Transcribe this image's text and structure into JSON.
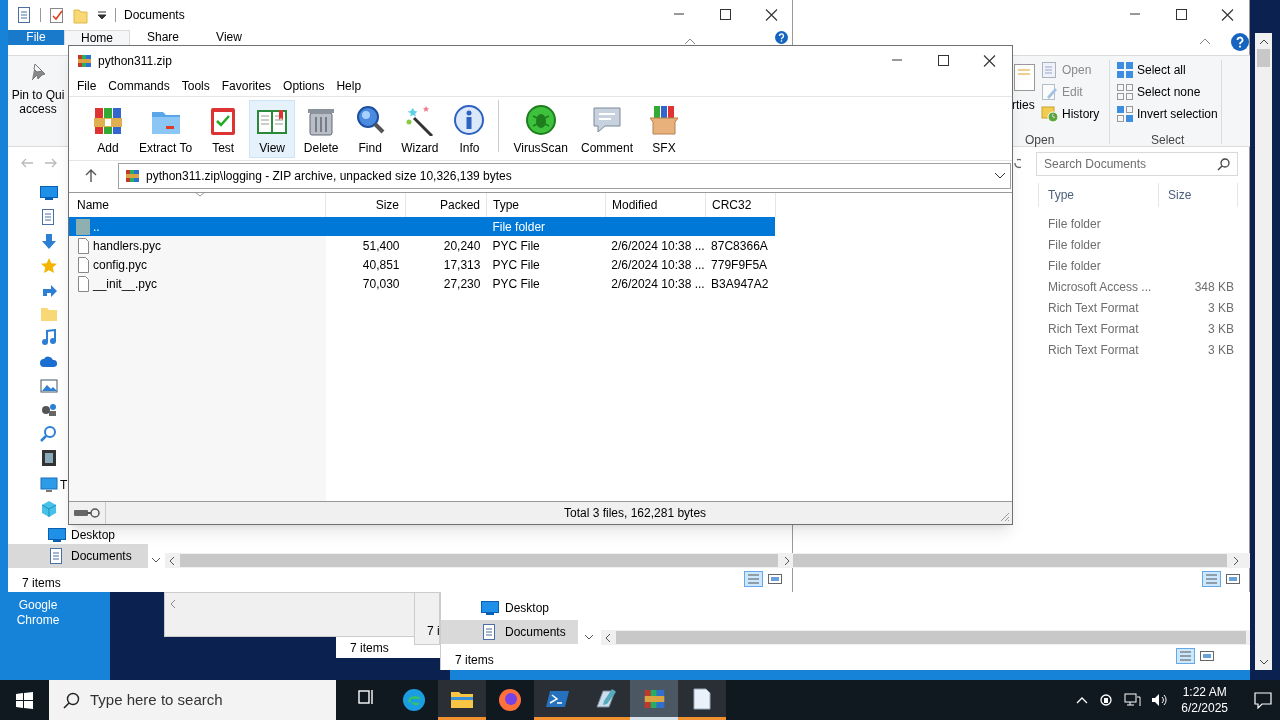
{
  "desktop": {
    "icons": [
      {
        "label": "Google Chrome"
      }
    ]
  },
  "explorer_left": {
    "title": "Documents",
    "ribbon_tabs": [
      {
        "label": "File",
        "kind": "menu",
        "selected": false
      },
      {
        "label": "Home",
        "kind": "tab",
        "selected": true
      },
      {
        "label": "Share",
        "kind": "tab",
        "selected": false
      },
      {
        "label": "View",
        "kind": "tab",
        "selected": false
      }
    ],
    "pin_button": "Pin to Qui\naccess",
    "nav_items": [
      {
        "label": "T",
        "selected": false
      },
      {
        "label": "Desktop",
        "selected": false
      },
      {
        "label": "Documents",
        "selected": true
      }
    ],
    "status": "7 items"
  },
  "explorer_right": {
    "properties_partial": "rties",
    "open_group": {
      "label": "Open",
      "items": [
        {
          "label": "Open",
          "disabled": true
        },
        {
          "label": "Edit",
          "disabled": true
        },
        {
          "label": "History",
          "disabled": false
        }
      ]
    },
    "select_group": {
      "label": "Select",
      "items": [
        "Select all",
        "Select none",
        "Invert selection"
      ]
    },
    "search": {
      "placeholder": "Search Documents"
    },
    "columns": [
      "Type",
      "Size"
    ],
    "rows": [
      {
        "type": "File folder"
      },
      {
        "type": "File folder"
      },
      {
        "type": "File folder"
      },
      {
        "type": "Microsoft Access ...",
        "size": "348 KB"
      },
      {
        "type": "Rich Text Format",
        "size": "3 KB"
      },
      {
        "type": "Rich Text Format",
        "size": "3 KB"
      },
      {
        "type": "Rich Text Format",
        "size": "3 KB"
      }
    ]
  },
  "explorer_bottom": {
    "nav_items": [
      {
        "label": "Desktop",
        "selected": false
      },
      {
        "label": "Documents",
        "selected": true
      }
    ],
    "status": "7 items"
  },
  "window_middle": {
    "status": "7 items"
  },
  "window_partial": {
    "status": "7 i"
  },
  "winrar": {
    "title": "python311.zip",
    "menu": [
      "File",
      "Commands",
      "Tools",
      "Favorites",
      "Options",
      "Help"
    ],
    "toolbar": [
      {
        "label": "Add",
        "selected": false
      },
      {
        "label": "Extract To",
        "selected": false
      },
      {
        "label": "Test",
        "selected": false
      },
      {
        "label": "View",
        "selected": true
      },
      {
        "label": "Delete",
        "selected": false
      },
      {
        "label": "Find",
        "selected": false
      },
      {
        "label": "Wizard",
        "selected": false
      },
      {
        "label": "Info",
        "selected": false
      },
      {
        "label": "VirusScan",
        "selected": false
      },
      {
        "label": "Comment",
        "selected": false
      },
      {
        "label": "SFX",
        "selected": false
      }
    ],
    "address": "python311.zip\\logging - ZIP archive, unpacked size 10,326,139 bytes",
    "columns": [
      "Name",
      "Size",
      "Packed",
      "Type",
      "Modified",
      "CRC32"
    ],
    "rows": [
      {
        "kind": "folder",
        "name": "..",
        "type": "File folder",
        "selected": true
      },
      {
        "kind": "file",
        "name": "handlers.pyc",
        "size": "51,400",
        "packed": "20,240",
        "type": "PYC File",
        "modified": "2/6/2024 10:38 ...",
        "crc32": "87C8366A",
        "selected": false
      },
      {
        "kind": "file",
        "name": "config.pyc",
        "size": "40,851",
        "packed": "17,313",
        "type": "PYC File",
        "modified": "2/6/2024 10:38 ...",
        "crc32": "779F9F5A",
        "selected": false
      },
      {
        "kind": "file",
        "name": "__init__.pyc",
        "size": "70,030",
        "packed": "27,230",
        "type": "PYC File",
        "modified": "2/6/2024 10:38 ...",
        "crc32": "B3A947A2",
        "selected": false
      }
    ],
    "status": "Total 3 files, 162,281 bytes"
  },
  "taskbar": {
    "search": {
      "placeholder": "Type here to search"
    },
    "apps": [
      {
        "kind": "taskview",
        "running": false,
        "selected": false
      },
      {
        "kind": "edge",
        "running": false,
        "selected": false
      },
      {
        "kind": "explorer",
        "running": true,
        "selected": false
      },
      {
        "kind": "firefox",
        "running": false,
        "selected": false
      },
      {
        "kind": "powershell",
        "running": true,
        "selected": false
      },
      {
        "kind": "editor",
        "running": true,
        "selected": false
      },
      {
        "kind": "winrar",
        "running": true,
        "selected": true
      },
      {
        "kind": "notepad",
        "running": true,
        "selected": false
      }
    ],
    "time": "1:22 AM",
    "date": "6/2/2025"
  }
}
